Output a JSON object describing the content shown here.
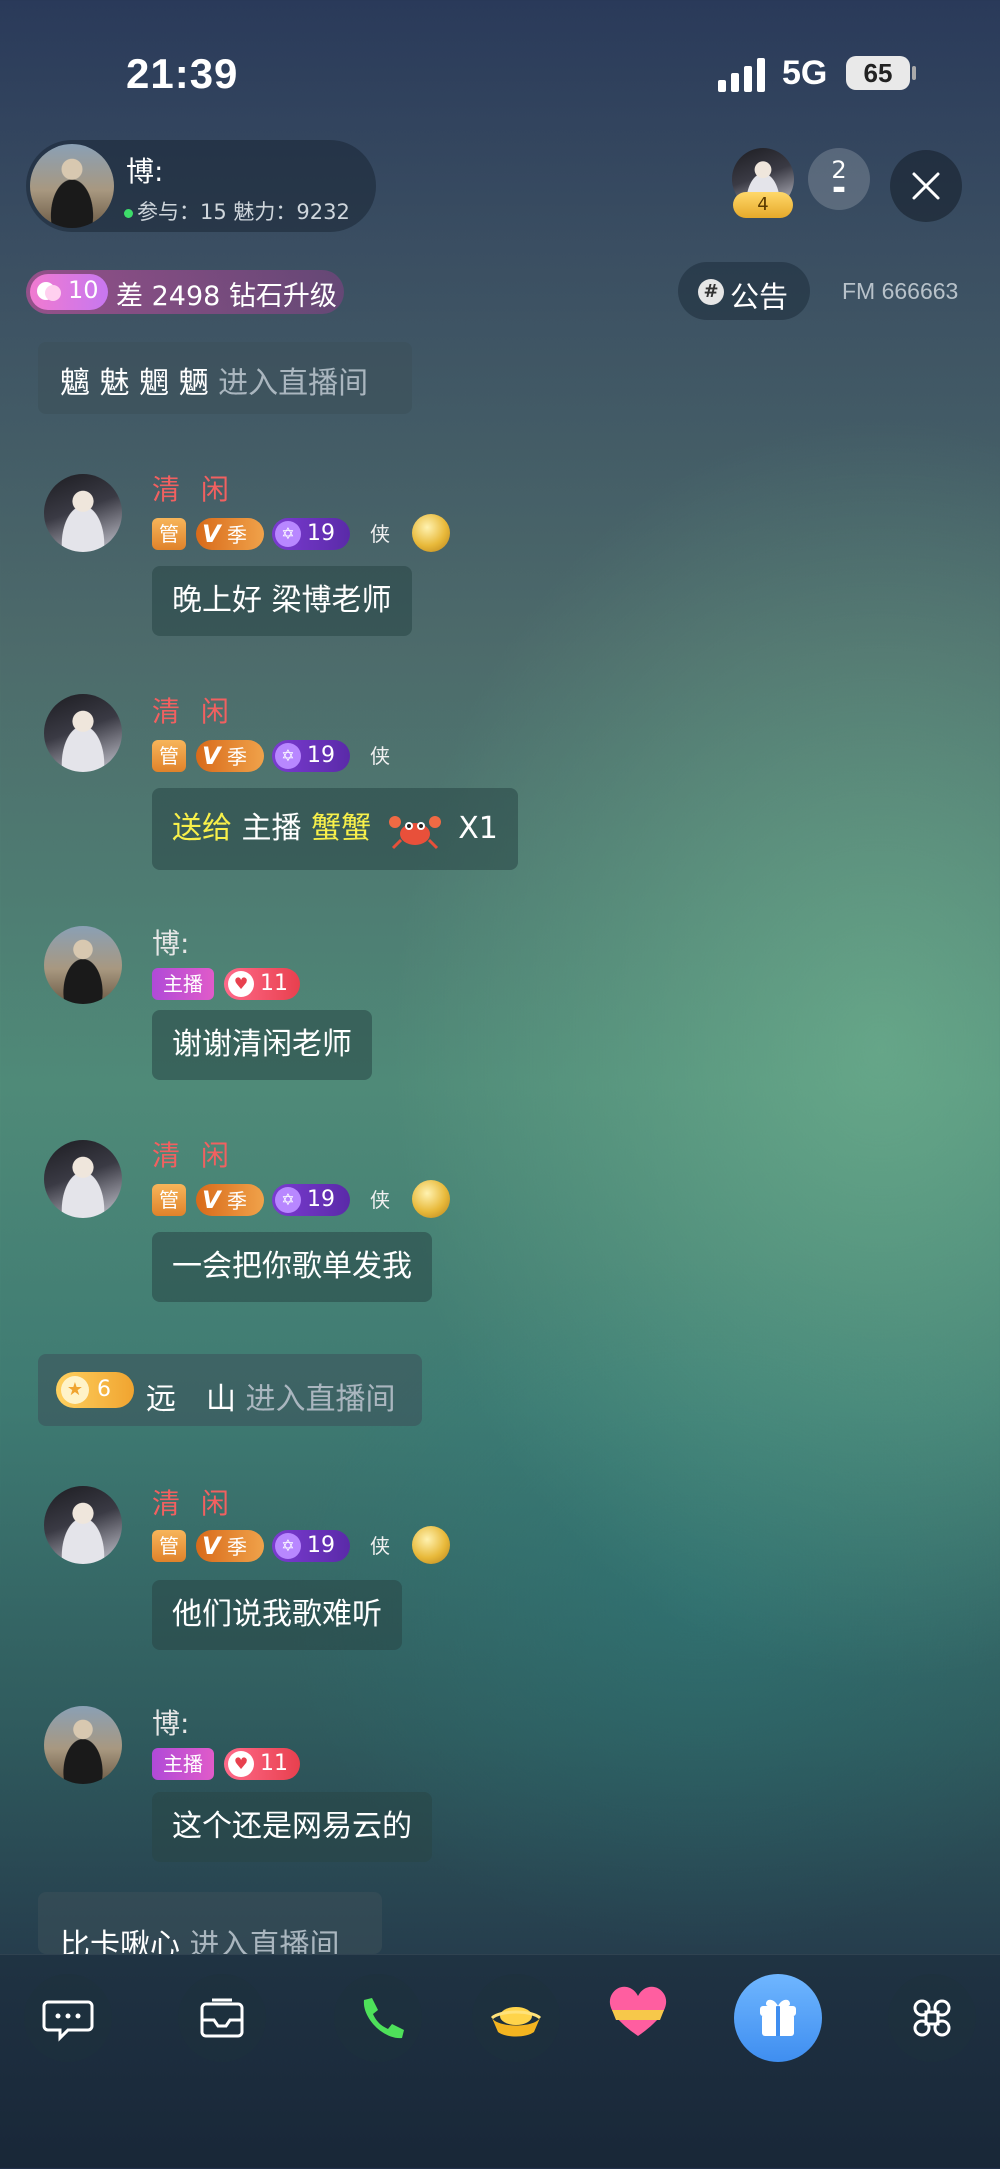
{
  "status_bar": {
    "time": "21:39",
    "network": "5G",
    "battery": "65"
  },
  "host": {
    "name": "博:",
    "stats": "参与：15 魅力：9232"
  },
  "viewers": {
    "badge": "4",
    "count": "2"
  },
  "level": {
    "number": "10",
    "text": "差 2498 钻石升级"
  },
  "notice": {
    "label": "公告"
  },
  "fm_id": "FM 666663",
  "messages": {
    "sys1": {
      "name": "魑 魅 魍 魉",
      "action": "进入直播间"
    },
    "m1": {
      "name": "清 闲",
      "guan": "管",
      "vip": "季",
      "level": "19",
      "text": "晚上好 梁博老师"
    },
    "m2": {
      "name": "清 闲",
      "guan": "管",
      "vip": "季",
      "level": "19",
      "gift_prefix": "送给",
      "gift_target": "主播",
      "gift_name": "蟹蟹",
      "gift_count": "X1"
    },
    "m3": {
      "name": "博:",
      "role": "主播",
      "level": "11",
      "text": "谢谢清闲老师"
    },
    "m4": {
      "name": "清 闲",
      "guan": "管",
      "vip": "季",
      "level": "19",
      "text": "一会把你歌单发我"
    },
    "sys2": {
      "level": "6",
      "name": "远　山",
      "action": "进入直播间"
    },
    "m5": {
      "name": "清 闲",
      "guan": "管",
      "vip": "季",
      "level": "19",
      "text": "他们说我歌难听"
    },
    "m6": {
      "name": "博:",
      "role": "主播",
      "level": "11",
      "text": "这个还是网易云的"
    },
    "sys3": {
      "name": "比卡啾心",
      "action": "进入直播间"
    }
  },
  "shield_label": "侠",
  "colors": {
    "accent_red": "#f26060",
    "gift_yellow": "#f8f04a",
    "online": "#3ddc6a"
  }
}
